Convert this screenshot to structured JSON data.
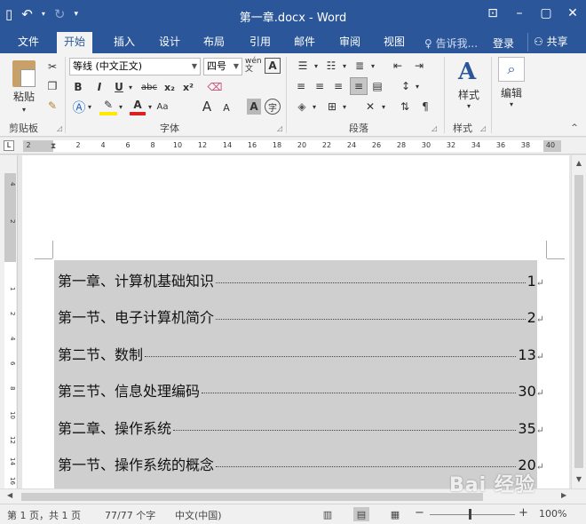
{
  "titlebar": {
    "title": "第一章.docx - Word",
    "qat": {
      "save_icon": "save-icon",
      "undo_icon": "undo-icon",
      "redo_icon": "redo-icon",
      "customize_icon": "customize-icon"
    },
    "controls": [
      "ribbon-options-icon",
      "minimize-icon",
      "restore-icon",
      "close-icon"
    ]
  },
  "tabs": [
    {
      "label": "文件"
    },
    {
      "label": "开始"
    },
    {
      "label": "插入"
    },
    {
      "label": "设计"
    },
    {
      "label": "布局"
    },
    {
      "label": "引用"
    },
    {
      "label": "邮件"
    },
    {
      "label": "审阅"
    },
    {
      "label": "视图"
    }
  ],
  "tell_me": "♀ 告诉我...",
  "login": "登录",
  "share": "共享",
  "ribbon": {
    "clipboard": {
      "paste_label": "粘贴",
      "group_label": "剪贴板"
    },
    "font": {
      "font_name": "等线 (中文正文)",
      "font_size": "四号",
      "group_label": "字体",
      "bold": "B",
      "italic": "I",
      "underline": "U",
      "strike": "abc",
      "subscript": "x₂",
      "superscript": "x²",
      "wen": "wén 文",
      "A_box": "A",
      "A_big": "A",
      "A_small": "A",
      "char_shade": "A",
      "circle_char": "字"
    },
    "paragraph": {
      "group_label": "段落"
    },
    "styles": {
      "label": "样式",
      "group_label": "样式"
    },
    "editing": {
      "label": "编辑"
    }
  },
  "ruler": {
    "ticks": [
      "2",
      "2",
      "4",
      "6",
      "8",
      "10",
      "12",
      "14",
      "16",
      "18",
      "20",
      "22",
      "24",
      "26",
      "28",
      "30",
      "32",
      "34",
      "36",
      "38",
      "40"
    ]
  },
  "vruler": {
    "ticks": [
      "4",
      "2",
      "1",
      "2",
      "4",
      "6",
      "8",
      "10",
      "12",
      "14",
      "16"
    ]
  },
  "document": {
    "toc": [
      {
        "title": "第一章、计算机基础知识",
        "page": "1"
      },
      {
        "title": "第一节、电子计算机简介",
        "page": "2"
      },
      {
        "title": "第二节、数制",
        "page": "13"
      },
      {
        "title": "第三节、信息处理编码",
        "page": "30"
      },
      {
        "title": "第二章、操作系统",
        "page": "35"
      },
      {
        "title": "第一节、操作系统的概念",
        "page": "20"
      }
    ],
    "para_mark": "↵",
    "selection_color": "#cfcfcf"
  },
  "statusbar": {
    "page": "第 1 页，共 1 页",
    "words": "77/77 个字",
    "language": "中文(中国)",
    "zoom": "100%"
  },
  "watermark": "Bai 经验",
  "colors": {
    "accent": "#2b579a",
    "ribbon_bg": "#f3f3f3"
  }
}
